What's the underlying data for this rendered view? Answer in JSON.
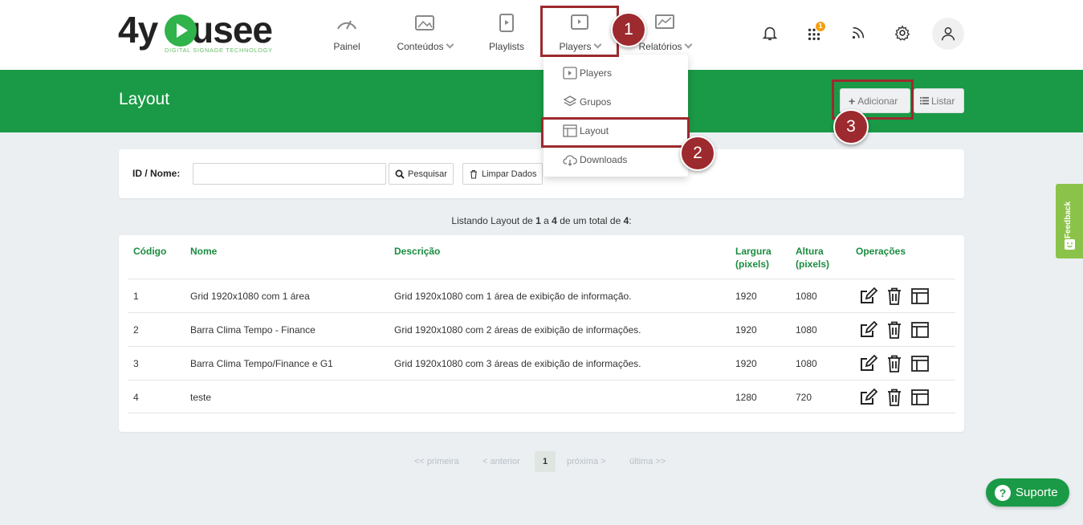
{
  "brand": {
    "logo_text_pre": "4y",
    "logo_text_post": "usee",
    "tagline": "DIGITAL SIGNAGE TECHNOLOGY",
    "primary_color": "#1a9a46",
    "annotation_color": "#9c2a2e"
  },
  "nav": {
    "painel": "Painel",
    "conteudos": "Conteúdos",
    "playlists": "Playlists",
    "players": "Players",
    "relatorios": "Relatórios"
  },
  "top_icons": {
    "notifications": "bell-icon",
    "apps": "grid-dots-icon",
    "apps_badge": "1",
    "feed": "rss-icon",
    "settings": "gear-icon",
    "user": "user-icon"
  },
  "players_menu": {
    "items": [
      {
        "label": "Players",
        "icon": "player-screen-icon"
      },
      {
        "label": "Grupos",
        "icon": "layers-icon"
      },
      {
        "label": "Layout",
        "icon": "layout-icon"
      },
      {
        "label": "Downloads",
        "icon": "cloud-download-icon"
      }
    ]
  },
  "header": {
    "title": "Layout",
    "add_label": "Adicionar",
    "list_label": "Listar"
  },
  "search": {
    "label": "ID / Nome:",
    "value": "",
    "search_label": "Pesquisar",
    "clear_label": "Limpar Dados"
  },
  "summary": {
    "prefix": "Listando Layout de ",
    "from": "1",
    "mid1": " a ",
    "to": "4",
    "mid2": " de um total de ",
    "total": "4",
    "suffix": ":"
  },
  "table": {
    "headers": {
      "codigo": "Código",
      "nome": "Nome",
      "descricao": "Descrição",
      "largura_1": "Largura",
      "largura_2": "(pixels)",
      "altura_1": "Altura",
      "altura_2": "(pixels)",
      "operacoes": "Operações"
    },
    "rows": [
      {
        "codigo": "1",
        "nome": "Grid 1920x1080 com 1 área",
        "descricao": "Grid 1920x1080 com 1 área de exibição de informação.",
        "largura": "1920",
        "altura": "1080"
      },
      {
        "codigo": "2",
        "nome": "Barra Clima Tempo - Finance",
        "descricao": "Grid 1920x1080 com 2 áreas de exibição de informações.",
        "largura": "1920",
        "altura": "1080"
      },
      {
        "codigo": "3",
        "nome": "Barra Clima Tempo/Finance e G1",
        "descricao": "Grid 1920x1080 com 3 áreas de exibição de informações.",
        "largura": "1920",
        "altura": "1080"
      },
      {
        "codigo": "4",
        "nome": "teste",
        "descricao": "",
        "largura": "1280",
        "altura": "720"
      }
    ],
    "ops_icons": [
      "edit-icon",
      "trash-icon",
      "layout-icon"
    ]
  },
  "pagination": {
    "first": "<< primeira",
    "prev": "< anterior",
    "current": "1",
    "next": "próxima >",
    "last": "última >>"
  },
  "annotations": {
    "marker_1": "1",
    "marker_2": "2",
    "marker_3": "3"
  },
  "feedback_label": "Feedback",
  "support_label": "Suporte"
}
